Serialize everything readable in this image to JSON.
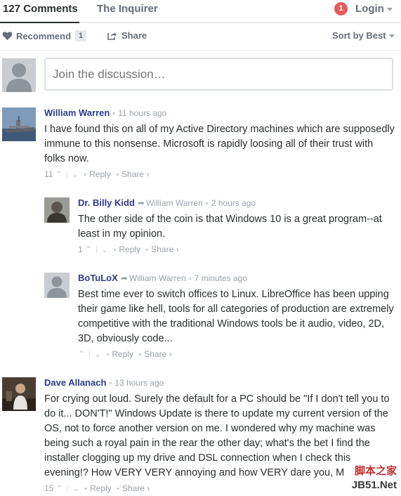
{
  "nav": {
    "comments_tab": "127 Comments",
    "community_tab": "The Inquirer",
    "notification_count": "1",
    "login_label": "Login"
  },
  "actions": {
    "recommend_label": "Recommend",
    "recommend_count": "1",
    "share_label": "Share",
    "sort_label": "Sort by Best"
  },
  "composer": {
    "placeholder": "Join the discussion…"
  },
  "comments": [
    {
      "author": "William Warren",
      "reply_to": "",
      "time": "11 hours ago",
      "text": "I have found this on all of my Active Directory machines which are supposedly immune to this nonsense. Microsoft is rapidly loosing all of their trust with folks now.",
      "upvotes": "11",
      "reply_label": "Reply",
      "share_label": "Share ›"
    },
    {
      "author": "Dr. Billy Kidd",
      "reply_to": "William Warren",
      "time": "2 hours ago",
      "text": "The other side of the coin is that Windows 10 is a great program--at least in my opinion.",
      "upvotes": "1",
      "reply_label": "Reply",
      "share_label": "Share ›"
    },
    {
      "author": "BoTuLoX",
      "reply_to": "William Warren",
      "time": "7 minutes ago",
      "text": "Best time ever to switch offices to Linux. LibreOffice has been upping their game like hell, tools for all categories of production are extremely competitive with the traditional Windows tools be it audio, video, 2D, 3D, obviously code...",
      "upvotes": "",
      "reply_label": "Reply",
      "share_label": "Share ›"
    },
    {
      "author": "Dave Allanach",
      "reply_to": "",
      "time": "13 hours ago",
      "text": "For crying out loud. Surely the default for a PC should be \"If I don't tell you to do it... DON'T!\" Windows Update is there to update my current version of the OS, not to force another version on me. I wondered why my machine was being such a royal pain in the rear the other day; what's the bet I find the installer clogging up my drive and DSL connection when I check this evening!? How VERY VERY annoying and how VERY dare you, M",
      "upvotes": "15",
      "reply_label": "Reply",
      "share_label": "Share ›"
    }
  ],
  "watermark": {
    "line1": "脚本之家",
    "line2": "JB51.Net"
  },
  "colors": {
    "author": "#2e3a8c",
    "badge": "#e35a5a",
    "muted": "#9aa2ab"
  }
}
